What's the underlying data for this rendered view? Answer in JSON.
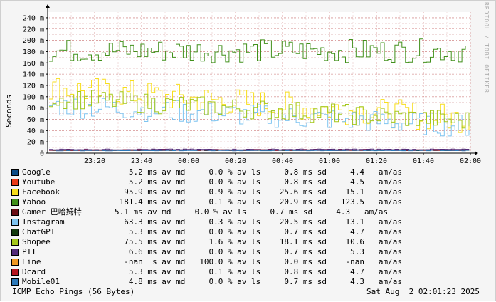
{
  "chart_data": {
    "type": "line",
    "ylabel": "Seconds",
    "ylim": [
      0,
      0.25
    ],
    "y_ticks": [
      "0",
      "20 m",
      "40 m",
      "60 m",
      "80 m",
      "100 m",
      "120 m",
      "140 m",
      "160 m",
      "180 m",
      "200 m",
      "220 m",
      "240 m"
    ],
    "x_ticks": [
      "23:20",
      "23:40",
      "00:00",
      "00:20",
      "00:40",
      "01:00",
      "01:20",
      "01:40",
      "02:00"
    ],
    "x_range": [
      "23:00",
      "02:00"
    ],
    "grid": true,
    "series": [
      {
        "name": "Google",
        "color": "#0d4b85",
        "level": 0.0052,
        "spread": 0.0008
      },
      {
        "name": "Youtube",
        "color": "#ea3b18",
        "level": 0.0052,
        "spread": 0.0008
      },
      {
        "name": "Facebook",
        "color": "#f7de1c",
        "start": 0.115,
        "end": 0.06,
        "spread": 0.0256
      },
      {
        "name": "Yahoo",
        "color": "#41901b",
        "level": 0.1814,
        "spread": 0.0209
      },
      {
        "name": "Gamer 巴哈姆特",
        "color": "#6b0e15",
        "level": 0.0051,
        "spread": 0.0007
      },
      {
        "name": "Instagram",
        "color": "#7ec4f0",
        "start": 0.085,
        "end": 0.048,
        "spread": 0.0205
      },
      {
        "name": "ChatGPT",
        "color": "#143b0e",
        "level": 0.0053,
        "spread": 0.0007
      },
      {
        "name": "Shopee",
        "color": "#a4c71a",
        "start": 0.098,
        "end": 0.057,
        "spread": 0.0181
      },
      {
        "name": "PTT",
        "color": "#522a78",
        "level": 0.0066,
        "spread": 0.0007
      },
      {
        "name": "Line",
        "color": "#f09822",
        "level": 0,
        "spread": 0
      },
      {
        "name": "Dcard",
        "color": "#b6151f",
        "level": 0.0053,
        "spread": 0.0008
      },
      {
        "name": "Mobile01",
        "color": "#2c79b9",
        "level": 0.0048,
        "spread": 0.0007
      }
    ]
  },
  "legend": [
    {
      "name": "Google",
      "color": "#0d4b85",
      "stats": "   5.2 ms av md     0.0 % av ls     0.8 ms sd     4.4   am/as"
    },
    {
      "name": "Youtube",
      "color": "#ea3b18",
      "stats": "   5.2 ms av md     0.0 % av ls     0.8 ms sd     4.5   am/as"
    },
    {
      "name": "Facebook",
      "color": "#f7de1c",
      "stats": "  95.9 ms av md     0.9 % av ls    25.6 ms sd    15.1   am/as"
    },
    {
      "name": "Yahoo",
      "color": "#41901b",
      "stats": " 181.4 ms av md     0.1 % av ls    20.9 ms sd   123.5   am/as"
    },
    {
      "name": "Gamer 巴哈姆特",
      "color": "#6b0e15",
      "stats": "5.1 ms av md     0.0 % av ls     0.7 ms sd     4.3   am/as",
      "wide": true
    },
    {
      "name": "Instagram",
      "color": "#7ec4f0",
      "stats": "  63.3 ms av md     0.3 % av ls    20.5 ms sd    13.1   am/as"
    },
    {
      "name": "ChatGPT",
      "color": "#143b0e",
      "stats": "   5.3 ms av md     0.0 % av ls     0.7 ms sd     4.7   am/as"
    },
    {
      "name": "Shopee",
      "color": "#a4c71a",
      "stats": "  75.5 ms av md     1.6 % av ls    18.1 ms sd    10.6   am/as"
    },
    {
      "name": "PTT",
      "color": "#522a78",
      "stats": "   6.6 ms av md     0.0 % av ls     0.7 ms sd     5.3   am/as"
    },
    {
      "name": "Line",
      "color": "#f09822",
      "stats": "  -nan  s av md   100.0 % av ls     0.0 ms sd    -nan   am/as"
    },
    {
      "name": "Dcard",
      "color": "#b6151f",
      "stats": "   5.3 ms av md     0.1 % av ls     0.8 ms sd     4.7   am/as"
    },
    {
      "name": "Mobile01",
      "color": "#2c79b9",
      "stats": "   4.8 ms av md     0.0 % av ls     0.7 ms sd     4.3   am/as"
    }
  ],
  "footer": {
    "left": "ICMP Echo Pings (56 Bytes)",
    "right": "Sat Aug  2 02:01:23 2025"
  },
  "watermark": "RRDTOOL / TOBI OETIKER"
}
